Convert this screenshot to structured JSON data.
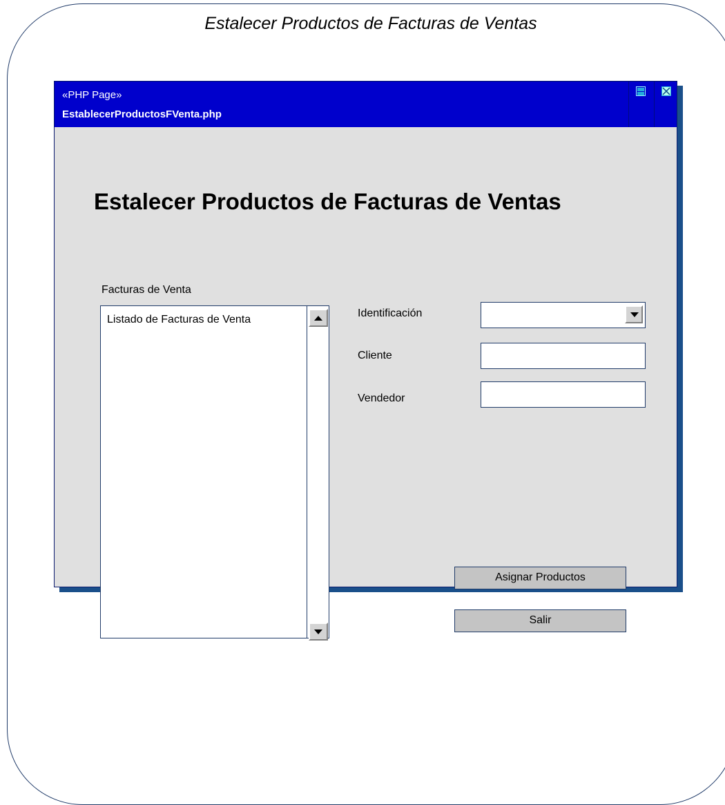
{
  "diagram": {
    "title": "Estalecer Productos de Facturas de Ventas"
  },
  "window": {
    "stereotype": "«PHP Page»",
    "page_name": "EstablecerProductosFVenta.php",
    "controls": [
      "maximize-icon",
      "close-icon"
    ]
  },
  "form": {
    "heading": "Estalecer Productos de Facturas de Ventas",
    "invoices": {
      "label": "Facturas de Venta",
      "items": [
        "Listado de Facturas de Venta"
      ]
    },
    "fields": {
      "identificacion": {
        "label": "Identificación",
        "value": ""
      },
      "cliente": {
        "label": "Cliente",
        "value": ""
      },
      "vendedor": {
        "label": "Vendedor",
        "value": ""
      }
    },
    "buttons": {
      "assign": "Asignar Productos",
      "exit": "Salir"
    }
  },
  "colors": {
    "titlebar": "#0000cc",
    "window_bg": "#e0e0e0",
    "border": "#1f3a68"
  }
}
